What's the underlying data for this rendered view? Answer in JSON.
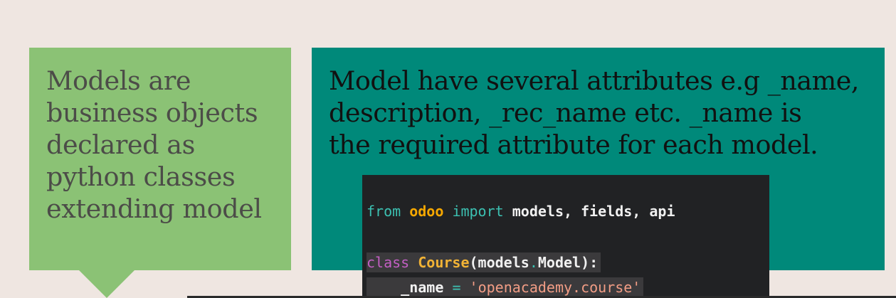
{
  "left_panel": {
    "lines": [
      "Models are",
      "business objects",
      "declared as",
      "python classes",
      "extending model"
    ]
  },
  "right_panel": {
    "lines": [
      "Model have several attributes e.g _name,",
      "description, _rec_name etc. _name is",
      "the required attribute for each model."
    ]
  },
  "code": {
    "line1": {
      "from": "from",
      "module": "odoo",
      "import": "import",
      "names": "models, fields, api"
    },
    "line2": {
      "keyword": "class",
      "class_name": "Course",
      "paren_open": "(models",
      "dot": ".",
      "base": "Model):"
    },
    "line3": {
      "indent": "    ",
      "attr": "_name",
      "eq": "=",
      "value": "'openacademy.course'"
    }
  },
  "colors": {
    "background": "#efe6e1",
    "left_box": "#8bc275",
    "right_box": "#00897a",
    "code_bg": "#212224"
  }
}
